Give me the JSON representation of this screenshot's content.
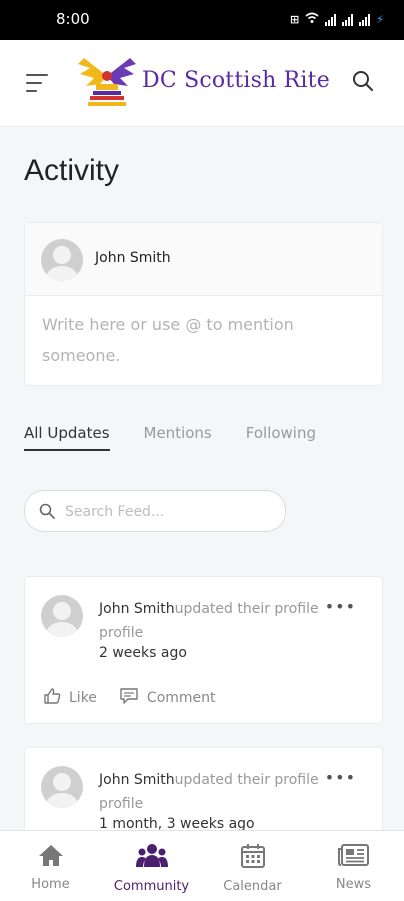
{
  "status": {
    "time": "8:00"
  },
  "header": {
    "brand": "DC Scottish Rite"
  },
  "page": {
    "title": "Activity"
  },
  "composer": {
    "user": "John Smith",
    "placeholder": "Write here or use @ to mention someone."
  },
  "tabs": [
    {
      "label": "All Updates",
      "active": true
    },
    {
      "label": "Mentions",
      "active": false
    },
    {
      "label": "Following",
      "active": false
    }
  ],
  "search": {
    "placeholder": "Search Feed..."
  },
  "feed": [
    {
      "user": "John Smith",
      "action": "updated their profile",
      "action2": "profile",
      "time": "2 weeks ago",
      "like": "Like",
      "comment": "Comment"
    },
    {
      "user": "John Smith",
      "action": "updated their profile",
      "action2": "profile",
      "time": "1 month, 3 weeks ago"
    }
  ],
  "nav": [
    {
      "label": "Home",
      "icon": "home-icon",
      "active": false
    },
    {
      "label": "Community",
      "icon": "community-icon",
      "active": true
    },
    {
      "label": "Calendar",
      "icon": "calendar-icon",
      "active": false
    },
    {
      "label": "News",
      "icon": "news-icon",
      "active": false
    }
  ],
  "colors": {
    "brand": "#5b2aa0",
    "nav_active": "#4a1f6e"
  }
}
